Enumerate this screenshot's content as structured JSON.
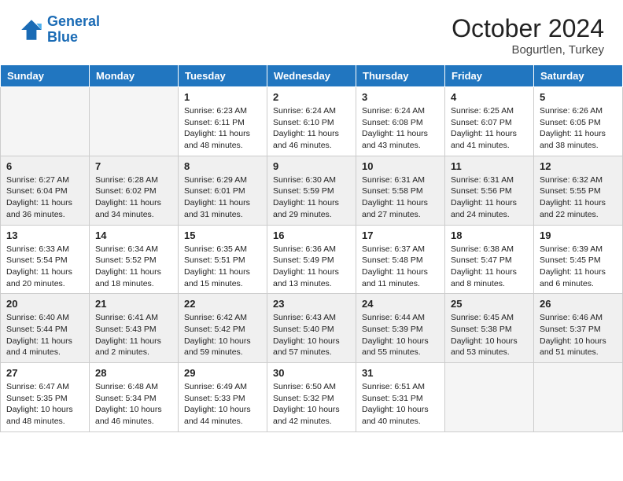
{
  "header": {
    "logo_line1": "General",
    "logo_line2": "Blue",
    "month_year": "October 2024",
    "location": "Bogurtlen, Turkey"
  },
  "weekdays": [
    "Sunday",
    "Monday",
    "Tuesday",
    "Wednesday",
    "Thursday",
    "Friday",
    "Saturday"
  ],
  "weeks": [
    [
      {
        "day": "",
        "text": ""
      },
      {
        "day": "",
        "text": ""
      },
      {
        "day": "1",
        "text": "Sunrise: 6:23 AM\nSunset: 6:11 PM\nDaylight: 11 hours and 48 minutes."
      },
      {
        "day": "2",
        "text": "Sunrise: 6:24 AM\nSunset: 6:10 PM\nDaylight: 11 hours and 46 minutes."
      },
      {
        "day": "3",
        "text": "Sunrise: 6:24 AM\nSunset: 6:08 PM\nDaylight: 11 hours and 43 minutes."
      },
      {
        "day": "4",
        "text": "Sunrise: 6:25 AM\nSunset: 6:07 PM\nDaylight: 11 hours and 41 minutes."
      },
      {
        "day": "5",
        "text": "Sunrise: 6:26 AM\nSunset: 6:05 PM\nDaylight: 11 hours and 38 minutes."
      }
    ],
    [
      {
        "day": "6",
        "text": "Sunrise: 6:27 AM\nSunset: 6:04 PM\nDaylight: 11 hours and 36 minutes."
      },
      {
        "day": "7",
        "text": "Sunrise: 6:28 AM\nSunset: 6:02 PM\nDaylight: 11 hours and 34 minutes."
      },
      {
        "day": "8",
        "text": "Sunrise: 6:29 AM\nSunset: 6:01 PM\nDaylight: 11 hours and 31 minutes."
      },
      {
        "day": "9",
        "text": "Sunrise: 6:30 AM\nSunset: 5:59 PM\nDaylight: 11 hours and 29 minutes."
      },
      {
        "day": "10",
        "text": "Sunrise: 6:31 AM\nSunset: 5:58 PM\nDaylight: 11 hours and 27 minutes."
      },
      {
        "day": "11",
        "text": "Sunrise: 6:31 AM\nSunset: 5:56 PM\nDaylight: 11 hours and 24 minutes."
      },
      {
        "day": "12",
        "text": "Sunrise: 6:32 AM\nSunset: 5:55 PM\nDaylight: 11 hours and 22 minutes."
      }
    ],
    [
      {
        "day": "13",
        "text": "Sunrise: 6:33 AM\nSunset: 5:54 PM\nDaylight: 11 hours and 20 minutes."
      },
      {
        "day": "14",
        "text": "Sunrise: 6:34 AM\nSunset: 5:52 PM\nDaylight: 11 hours and 18 minutes."
      },
      {
        "day": "15",
        "text": "Sunrise: 6:35 AM\nSunset: 5:51 PM\nDaylight: 11 hours and 15 minutes."
      },
      {
        "day": "16",
        "text": "Sunrise: 6:36 AM\nSunset: 5:49 PM\nDaylight: 11 hours and 13 minutes."
      },
      {
        "day": "17",
        "text": "Sunrise: 6:37 AM\nSunset: 5:48 PM\nDaylight: 11 hours and 11 minutes."
      },
      {
        "day": "18",
        "text": "Sunrise: 6:38 AM\nSunset: 5:47 PM\nDaylight: 11 hours and 8 minutes."
      },
      {
        "day": "19",
        "text": "Sunrise: 6:39 AM\nSunset: 5:45 PM\nDaylight: 11 hours and 6 minutes."
      }
    ],
    [
      {
        "day": "20",
        "text": "Sunrise: 6:40 AM\nSunset: 5:44 PM\nDaylight: 11 hours and 4 minutes."
      },
      {
        "day": "21",
        "text": "Sunrise: 6:41 AM\nSunset: 5:43 PM\nDaylight: 11 hours and 2 minutes."
      },
      {
        "day": "22",
        "text": "Sunrise: 6:42 AM\nSunset: 5:42 PM\nDaylight: 10 hours and 59 minutes."
      },
      {
        "day": "23",
        "text": "Sunrise: 6:43 AM\nSunset: 5:40 PM\nDaylight: 10 hours and 57 minutes."
      },
      {
        "day": "24",
        "text": "Sunrise: 6:44 AM\nSunset: 5:39 PM\nDaylight: 10 hours and 55 minutes."
      },
      {
        "day": "25",
        "text": "Sunrise: 6:45 AM\nSunset: 5:38 PM\nDaylight: 10 hours and 53 minutes."
      },
      {
        "day": "26",
        "text": "Sunrise: 6:46 AM\nSunset: 5:37 PM\nDaylight: 10 hours and 51 minutes."
      }
    ],
    [
      {
        "day": "27",
        "text": "Sunrise: 6:47 AM\nSunset: 5:35 PM\nDaylight: 10 hours and 48 minutes."
      },
      {
        "day": "28",
        "text": "Sunrise: 6:48 AM\nSunset: 5:34 PM\nDaylight: 10 hours and 46 minutes."
      },
      {
        "day": "29",
        "text": "Sunrise: 6:49 AM\nSunset: 5:33 PM\nDaylight: 10 hours and 44 minutes."
      },
      {
        "day": "30",
        "text": "Sunrise: 6:50 AM\nSunset: 5:32 PM\nDaylight: 10 hours and 42 minutes."
      },
      {
        "day": "31",
        "text": "Sunrise: 6:51 AM\nSunset: 5:31 PM\nDaylight: 10 hours and 40 minutes."
      },
      {
        "day": "",
        "text": ""
      },
      {
        "day": "",
        "text": ""
      }
    ]
  ]
}
